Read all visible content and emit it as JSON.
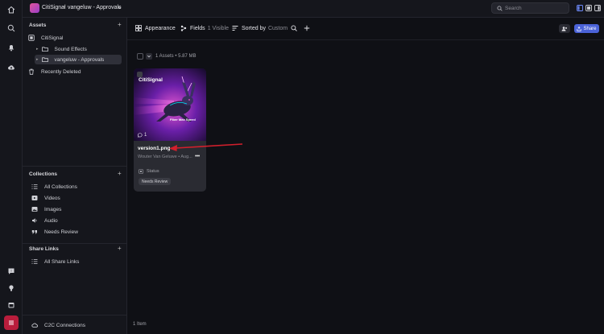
{
  "topbar": {
    "org_name": "CitiSignal",
    "separator": "/",
    "workspace_name": "vangeluw - Approvals",
    "search_placeholder": "Search"
  },
  "sidebar": {
    "assets_header": "Assets",
    "asset_tree": [
      {
        "label": "CitiSignal",
        "icon": "org-icon"
      },
      {
        "label": "Sound Effects",
        "icon": "folder-icon"
      },
      {
        "label": "vangeluw - Approvals",
        "icon": "folder-icon",
        "selected": true
      },
      {
        "label": "Recently Deleted",
        "icon": "trash-icon"
      }
    ],
    "collections_header": "Collections",
    "collections": [
      {
        "label": "All Collections",
        "icon": "list-icon"
      },
      {
        "label": "Videos",
        "icon": "video-icon"
      },
      {
        "label": "Images",
        "icon": "image-icon"
      },
      {
        "label": "Audio",
        "icon": "audio-icon"
      },
      {
        "label": "Needs Review",
        "icon": "quote-icon"
      }
    ],
    "share_links_header": "Share Links",
    "share_links": [
      {
        "label": "All Share Links",
        "icon": "list-icon"
      }
    ],
    "footer_link": "C2C Connections"
  },
  "toolbar": {
    "appearance_label": "Appearance",
    "fields_label": "Fields",
    "fields_visible": "1 Visible",
    "sorted_label": "Sorted by",
    "sorted_value": "Custom",
    "share_label": "Share"
  },
  "list": {
    "asset_count": "1 Assets • 5.87 MB",
    "footer_count": "1 Item"
  },
  "asset_card": {
    "filename": "version1.png",
    "meta": "Wouter Van Geluwe • Aug...",
    "comment_count": "1",
    "status_label": "Status",
    "status_value": "Needs Review",
    "thumbnail_brand": "CitiSignal",
    "thumbnail_caption": "Fiber Max Speed"
  },
  "colors": {
    "accent": "#4b63d8",
    "rail_active": "#b91d3c",
    "annotation_arrow": "#d11f2c"
  }
}
